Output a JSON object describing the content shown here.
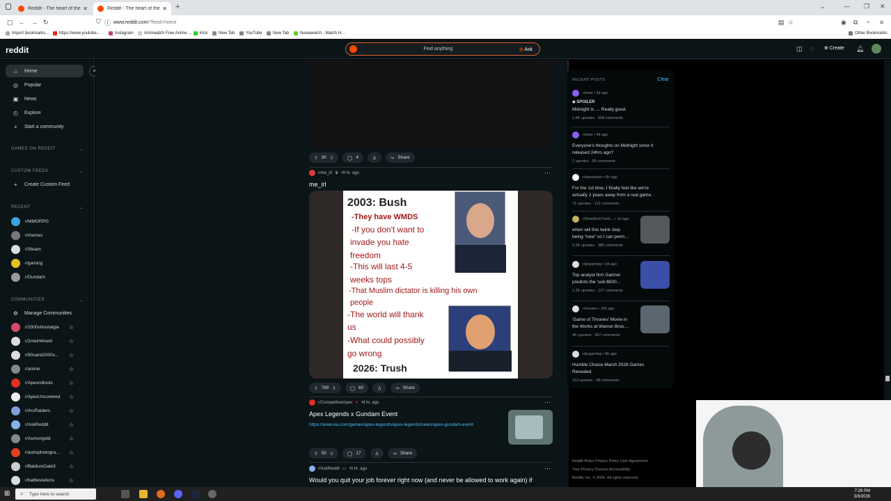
{
  "browser": {
    "tabs": [
      {
        "title": "Reddit - The heart of the intern"
      },
      {
        "title": "Reddit - The heart of the intern"
      }
    ],
    "url_host": "www.reddit.com",
    "url_path": "/?feed=home",
    "bookmarks": [
      "Import bookmarks...",
      "https://www.youtube...",
      "Instagram",
      "Animwatch Free Anime ...",
      "Kick",
      "New Tab",
      "YouTube",
      "New Tab",
      "Nuwawatch - Watch H..."
    ],
    "other_bookmarks": "Other Bookmarks"
  },
  "header": {
    "logo": "reddit",
    "search_placeholder": "Find anything",
    "ask_label": "Ask",
    "create_label": "Create"
  },
  "sidebar": {
    "nav": [
      {
        "label": "Home",
        "icon": "home-icon"
      },
      {
        "label": "Popular",
        "icon": "popular-icon"
      },
      {
        "label": "News",
        "icon": "news-icon"
      },
      {
        "label": "Explore",
        "icon": "explore-icon"
      },
      {
        "label": "Start a community",
        "icon": "plus-icon"
      }
    ],
    "games_heading": "GAMES ON REDDIT",
    "custom_feeds_heading": "CUSTOM FEEDS",
    "create_custom_feed": "Create Custom Feed",
    "recent_heading": "RECENT",
    "recent": [
      {
        "name": "r/MMORPG",
        "color": "#3aa3e0"
      },
      {
        "name": "r/memes",
        "color": "#777777"
      },
      {
        "name": "r/Steam",
        "color": "#dddddd"
      },
      {
        "name": "r/gaming",
        "color": "#e8c020"
      },
      {
        "name": "r/Gundam",
        "color": "#999999"
      }
    ],
    "communities_heading": "COMMUNITIES",
    "manage_communities": "Manage Communities",
    "communities": [
      {
        "name": "r/2000sNostalgia",
        "color": "#d44a6a"
      },
      {
        "name": "r/2meirl4meirl",
        "color": "#dddddd"
      },
      {
        "name": "r/90sand2000s...",
        "color": "#dddddd"
      },
      {
        "name": "r/anime",
        "color": "#888888"
      },
      {
        "name": "r/Apexrollouts",
        "color": "#e03020"
      },
      {
        "name": "r/ApexUncovered",
        "color": "#eeeeee"
      },
      {
        "name": "r/ArcRaiders",
        "color": "#7da0d8"
      },
      {
        "name": "r/AskReddit",
        "color": "#8ab0e8"
      },
      {
        "name": "r/Asmongold",
        "color": "#888888"
      },
      {
        "name": "r/astrophotogra...",
        "color": "#e04020"
      },
      {
        "name": "r/BaldursGate3",
        "color": "#cccccc"
      },
      {
        "name": "r/battlestations",
        "color": "#dddddd"
      }
    ]
  },
  "feed": {
    "post1_actions": {
      "votes": "30",
      "comments": "4",
      "share": "Share"
    },
    "post2": {
      "subreddit": "r/me_irl",
      "age": "9 hr. ago",
      "title": "me_irl",
      "meme_lines": {
        "top": "2003: Bush",
        "l1": "-They have WMDS",
        "l2": "-If you don't want to",
        "l3": "invade you hate",
        "l4": "freedom",
        "l5": "-This will last 4-5",
        "l6": "weeks tops",
        "l7": "-That Muslim dictator is killing his own",
        "l8": "people",
        "l9": "-The world will thank",
        "l10": "us",
        "l11": "-What could possibly",
        "l12": "go wrong",
        "bottom": "2026: Trush"
      },
      "votes": "789",
      "comments": "60",
      "share": "Share"
    },
    "post3": {
      "subreddit": "r/CompetitiveApex",
      "age": "9 hr. ago",
      "title": "Apex Legends x Gundam Event",
      "link": "https://www.ea.com/games/apex-legends/apex-legends/news/apex-gundam-event",
      "votes": "55",
      "comments": "17",
      "share": "Share"
    },
    "post4": {
      "subreddit": "r/AskReddit",
      "age": "3 hr. ago",
      "title": "Would you quit your job forever right now (and never be allowed to work again) if"
    }
  },
  "recent_posts": {
    "heading": "RECENT POSTS",
    "clear": "Clear",
    "items": [
      {
        "sub": "r/wow",
        "age": "3d ago",
        "flair": "SPOILER",
        "title1": "Midnight is .... Really good.",
        "title2": "",
        "stats": "1.8K upvotes · 608 comments",
        "color": "#8a5cf6"
      },
      {
        "sub": "r/wow",
        "age": "4d ago",
        "flair": "",
        "title1": "Everyone's thoughts on Midnight since it",
        "title2": "released 24hrs ago?",
        "stats": "2 upvotes · 56 comments",
        "color": "#8a5cf6"
      },
      {
        "sub": "r/starcitizen",
        "age": "6h ago",
        "flair": "",
        "title1": "For the 1st time, I finally feel like we're",
        "title2": "actually 2 years away from a real game.",
        "stats": "71 upvotes · 112 comments",
        "color": "#ffffff"
      },
      {
        "sub": "r/DeadlockTheG...",
        "age": "1d ago",
        "flair": "",
        "title1": "when will this twink stop",
        "title2": "being \"new\" so I can perm...",
        "stats": "3.2K upvotes · 386 comments",
        "color": "#c8b060"
      },
      {
        "sub": "r/pcgaming",
        "age": "2d ago",
        "flair": "",
        "title1": "Top analyst firm Gartner",
        "title2": "predicts the 'sub-$500...",
        "stats": "1.2K upvotes · 127 comments",
        "color": "#dddddd"
      },
      {
        "sub": "r/movies",
        "age": "10h ago",
        "flair": "",
        "title1": "'Game of Thrones' Movie in",
        "title2": "the Works at Warner Bros....",
        "stats": "4K upvotes · 957 comments",
        "color": "#dddddd"
      },
      {
        "sub": "r/pcgaming",
        "age": "8h ago",
        "flair": "",
        "title1": "Humble Choice March 2026 Games",
        "title2": "Revealed",
        "stats": "113 upvotes · 68 comments",
        "color": "#dddddd"
      }
    ]
  },
  "footer": {
    "line1": "Reddit Rules   Privacy Policy   User Agreement",
    "line2": "Your Privacy Choices   Accessibility",
    "line3": "Reddit, Inc. © 2026. All rights reserved."
  },
  "taskbar": {
    "search_placeholder": "Type here to search",
    "time": "7:26 PM",
    "date": "3/3/2026"
  }
}
